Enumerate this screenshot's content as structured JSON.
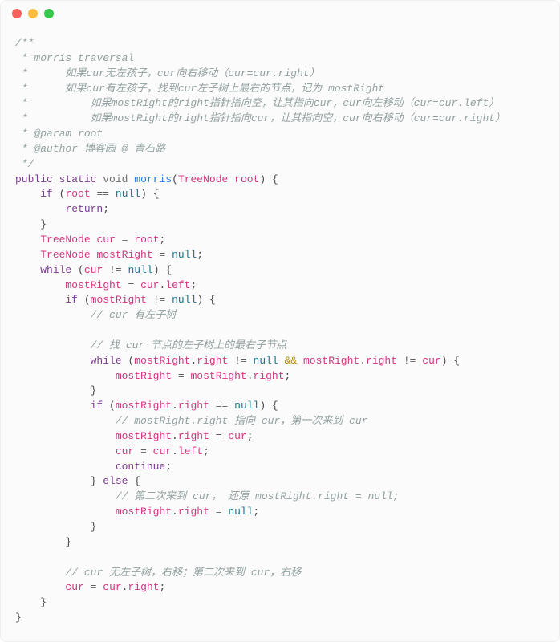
{
  "window": {
    "dots": [
      "close",
      "minimize",
      "zoom"
    ]
  },
  "code": {
    "c1": "/**",
    "c2": " * morris traversal",
    "c3": " *      如果cur无左孩子，cur向右移动（cur=cur.right）",
    "c4": " *      如果cur有左孩子，找到cur左子树上最右的节点，记为 mostRight",
    "c5": " *          如果mostRight的right指针指向空，让其指向cur，cur向左移动（cur=cur.left）",
    "c6": " *          如果mostRight的right指针指向cur，让其指向空，cur向右移动（cur=cur.right）",
    "c7": " * @param root",
    "c8": " * @author 博客园 @ 青石路",
    "c9": " */",
    "kw_public": "public",
    "kw_static": "static",
    "kw_void": "void",
    "fn_morris": "morris",
    "ty_treenode": "TreeNode",
    "id_root": "root",
    "kw_if": "if",
    "kw_null": "null",
    "kw_return": "return",
    "id_cur": "cur",
    "id_mostRight": "mostRight",
    "kw_while": "while",
    "prop_left": "left",
    "prop_right": "right",
    "op_andand": "&&",
    "cmt_has_left": "// cur 有左子树",
    "cmt_find": "// 找 cur 节点的左子树上的最右子节点",
    "cmt_point": "// mostRight.right 指向 cur，第一次来到 cur",
    "kw_continue": "continue",
    "kw_else": "else",
    "cmt_second": "// 第二次来到 cur， 还原 mostRight.right = null;",
    "cmt_noleft": "// cur 无左子树，右移；第二次来到 cur，右移"
  }
}
